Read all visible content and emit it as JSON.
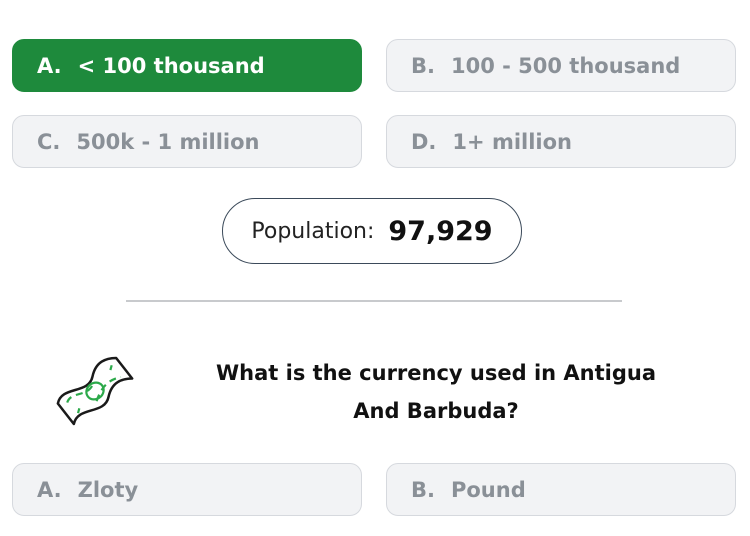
{
  "population_question": {
    "options": [
      {
        "letter": "A.",
        "label": "< 100 thousand",
        "selected": true
      },
      {
        "letter": "B.",
        "label": "100 - 500 thousand",
        "selected": false
      },
      {
        "letter": "C.",
        "label": "500k - 1 million",
        "selected": false
      },
      {
        "letter": "D.",
        "label": "1+ million",
        "selected": false
      }
    ],
    "result_label": "Population:",
    "result_value": "97,929"
  },
  "currency_question": {
    "icon": "money-bill-icon",
    "text": "What is the currency used in Antigua And Barbuda?",
    "options": [
      {
        "letter": "A.",
        "label": "Zloty"
      },
      {
        "letter": "B.",
        "label": "Pound"
      }
    ]
  },
  "colors": {
    "selected_green": "#1e8a3c",
    "option_bg": "#f2f3f5",
    "option_text": "#8a9097",
    "money_green": "#2ca94a"
  }
}
